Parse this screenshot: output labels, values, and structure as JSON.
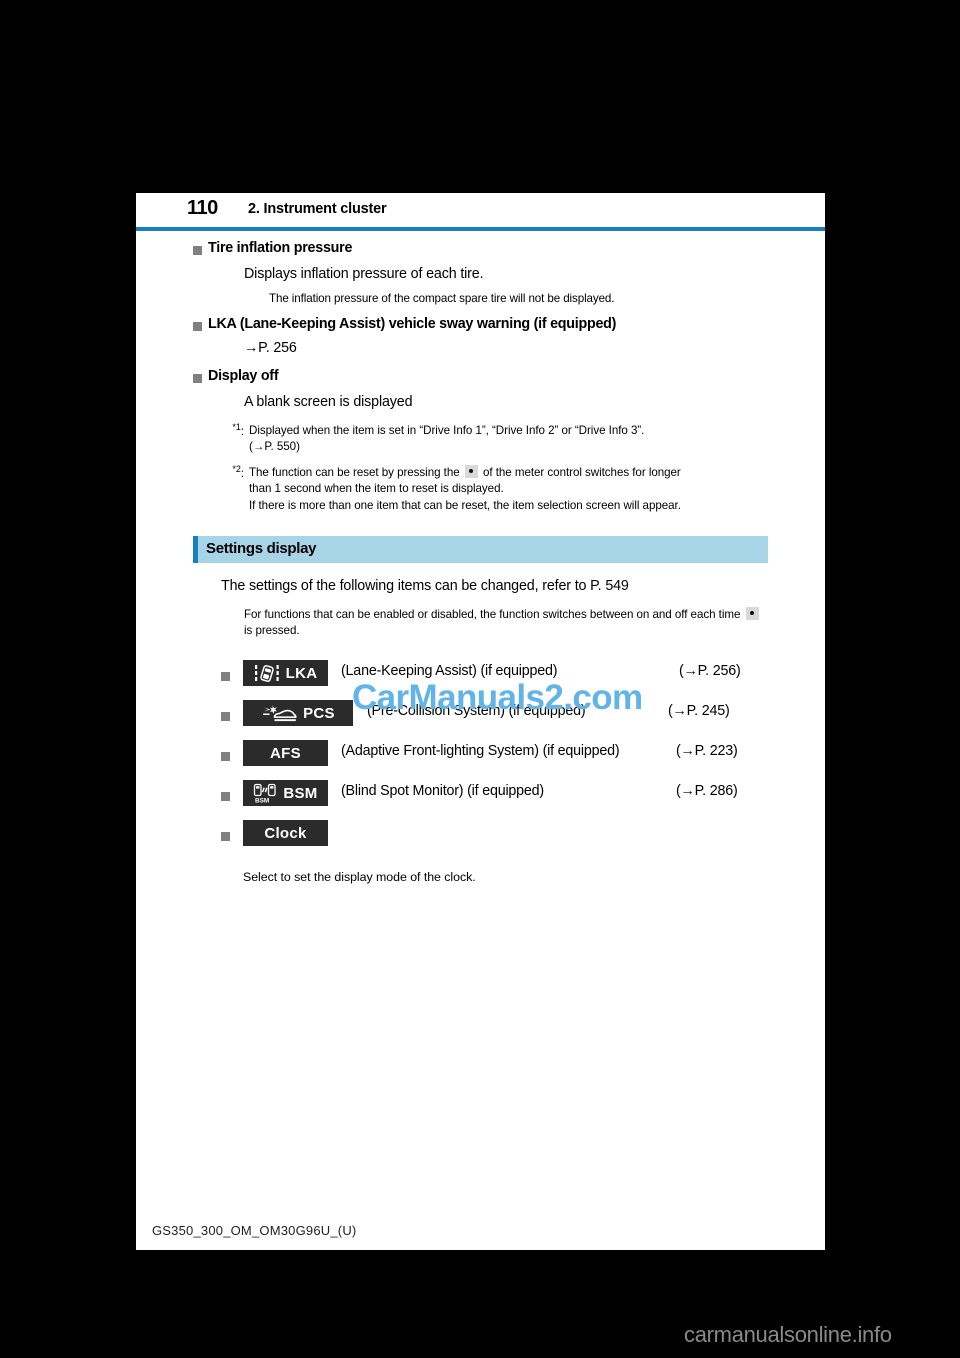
{
  "document": {
    "page_number": "110",
    "chapter_title": "2. Instrument cluster",
    "footer_code": "GS350_300_OM_OM30G96U_(U)"
  },
  "watermarks": {
    "overlay": "CarManuals2.com",
    "bottom": "carmanualsonline.info",
    "overlay_color": "#62b4e8",
    "bottom_color": "#8a8a8a"
  },
  "colors": {
    "rule_blue": "#1a7fc1",
    "section_bar_bg": "#a8d4e8",
    "bullet_gray": "#808080",
    "chip_bg": "#2b2b2b"
  },
  "body": {
    "entries": [
      {
        "heading": "Tire inflation pressure",
        "text": "Displays inflation pressure of each tire.",
        "note": "The inflation pressure of the compact spare tire will not be displayed."
      },
      {
        "heading": "LKA (Lane-Keeping Assist) vehicle sway warning (if equipped)",
        "reference": "→P. 256"
      },
      {
        "heading": "Display off",
        "text": "A blank screen is displayed"
      }
    ],
    "footnotes": [
      {
        "mark": "*1",
        "separator": ":",
        "line1": "Displayed when the item is set in “Drive Info 1”, “Drive Info 2” or “Drive Info 3”.",
        "line2": "(→P. 550)"
      },
      {
        "mark": "*2",
        "separator": ":",
        "line1_before": "The function can be reset by pressing the",
        "line1_after": "of the meter control switches for longer",
        "line2": "than 1 second when the item to reset is displayed.",
        "line3": "If there is more than one item that can be reset, the item selection screen will appear."
      }
    ]
  },
  "settings_section": {
    "bar_title": "Settings display",
    "intro": "The settings of the following items can be changed, refer to P. 549",
    "note_before": "For functions that can be enabled or disabled, the function switches between on and off each time",
    "note_after": "is pressed.",
    "items": [
      {
        "icon": "lka-lane-keeping-icon",
        "chip_label": "LKA",
        "description": "(Lane-Keeping Assist) (if equipped)",
        "reference": "(→P. 256)"
      },
      {
        "icon": "pcs-pre-collision-icon",
        "chip_label": "PCS",
        "description": "(Pre-Collision System) (if equipped)",
        "reference": "(→P. 245)"
      },
      {
        "icon": "",
        "chip_label": "AFS",
        "description": "(Adaptive Front-lighting System) (if equipped)",
        "reference": "(→P. 223)"
      },
      {
        "icon": "bsm-blind-spot-icon",
        "chip_label": "BSM",
        "description": "(Blind Spot Monitor) (if equipped)",
        "reference": "(→P. 286)"
      },
      {
        "icon": "",
        "chip_label": "Clock",
        "description": "",
        "reference": ""
      }
    ],
    "clock_note": "Select to set the display mode of the clock."
  }
}
